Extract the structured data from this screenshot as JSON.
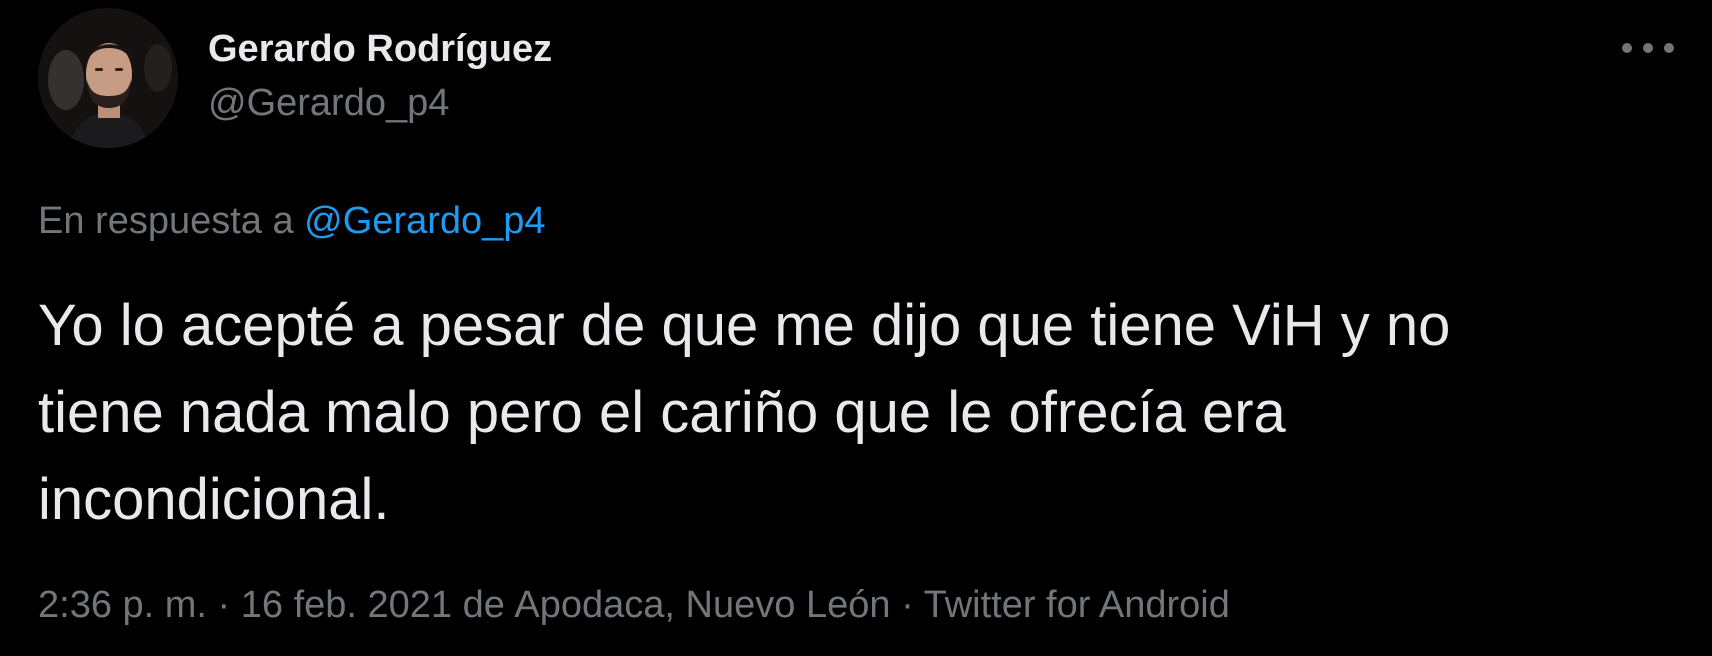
{
  "author": {
    "display_name": "Gerardo Rodríguez",
    "handle": "@Gerardo_p4"
  },
  "menu": {
    "icon": "more-horizontal-icon"
  },
  "reply": {
    "prefix": "En respuesta a",
    "mention": "@Gerardo_p4"
  },
  "tweet": {
    "lines": [
      "Yo lo acepté a pesar de que me dijo que tiene ViH y no",
      "tiene nada malo pero el cariño que le ofrecía era",
      "incondicional."
    ]
  },
  "meta": {
    "time": "2:36 p. m.",
    "date": "16 feb. 2021",
    "location_prefix": "de",
    "location": "Apodaca, Nuevo León",
    "source": "Twitter for Android",
    "separator": "·"
  },
  "colors": {
    "background": "#000000",
    "primary_text": "#e7e9ea",
    "secondary_text": "#71767b",
    "link": "#1d9bf0"
  }
}
